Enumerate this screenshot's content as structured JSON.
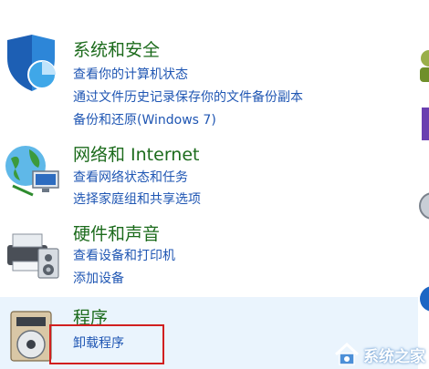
{
  "categories": [
    {
      "title": "系统和安全",
      "icon": "shield-icon",
      "links": [
        "查看你的计算机状态",
        "通过文件历史记录保存你的文件备份副本",
        "备份和还原(Windows 7)"
      ]
    },
    {
      "title": "网络和 Internet",
      "icon": "globe-network-icon",
      "links": [
        "查看网络状态和任务",
        "选择家庭组和共享选项"
      ]
    },
    {
      "title": "硬件和声音",
      "icon": "printer-speaker-icon",
      "links": [
        "查看设备和打印机",
        "添加设备"
      ]
    },
    {
      "title": "程序",
      "icon": "programs-disc-icon",
      "links": [
        "卸载程序"
      ]
    }
  ],
  "highlight_color": "#d11f1f",
  "watermark": {
    "text": "系统之家",
    "icon": "house-logo-icon"
  }
}
